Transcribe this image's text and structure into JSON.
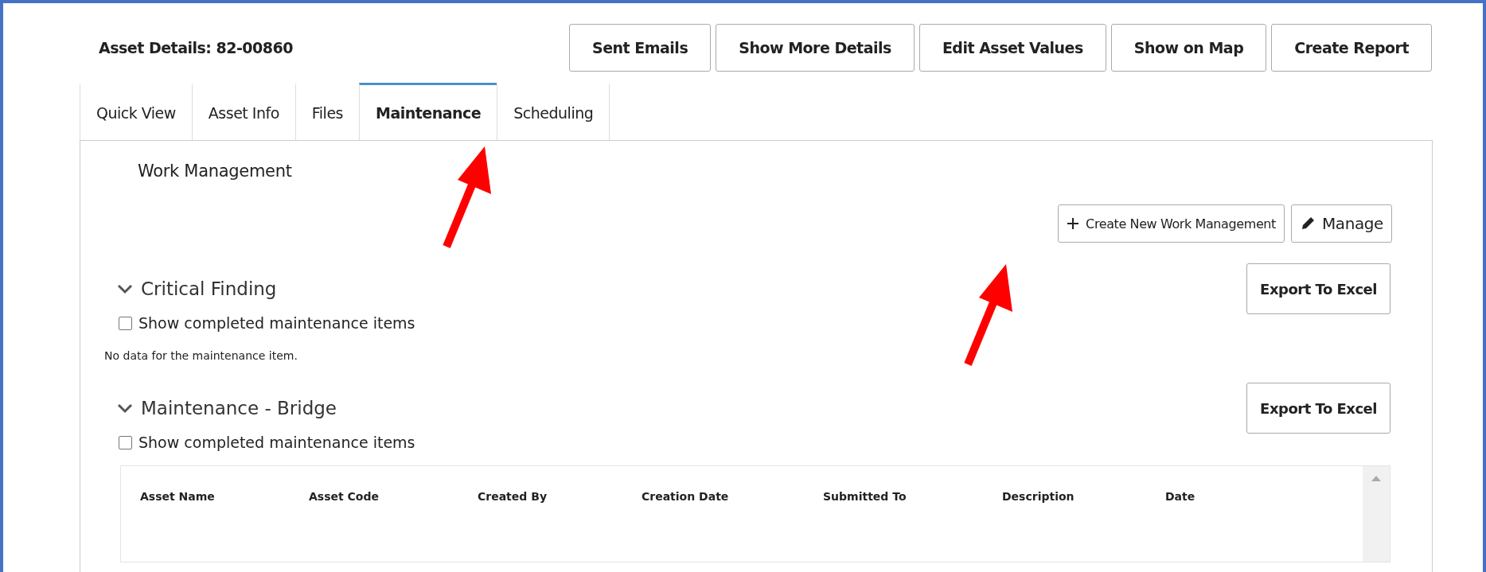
{
  "header": {
    "title": "Asset Details: 82-00860",
    "buttons": [
      "Sent Emails",
      "Show More Details",
      "Edit Asset Values",
      "Show on Map",
      "Create Report"
    ]
  },
  "tabs": [
    {
      "label": "Quick View",
      "selected": false
    },
    {
      "label": "Asset Info",
      "selected": false
    },
    {
      "label": "Files",
      "selected": false
    },
    {
      "label": "Maintenance",
      "selected": true
    },
    {
      "label": "Scheduling",
      "selected": false
    }
  ],
  "panel": {
    "title": "Work Management",
    "actions": [
      {
        "kind": "create",
        "label": "Create New Work Management"
      },
      {
        "kind": "manage",
        "label": "Manage"
      }
    ],
    "sections": [
      {
        "title": "Critical Finding",
        "expanded": true,
        "export_label": "Export To Excel",
        "show_completed": {
          "label": "Show completed maintenance items",
          "checked": false
        },
        "empty_message": "No data for the maintenance item."
      },
      {
        "title": "Maintenance - Bridge",
        "expanded": true,
        "export_label": "Export To Excel",
        "show_completed": {
          "label": "Show completed maintenance items",
          "checked": false
        },
        "table": {
          "columns": [
            "Asset Name",
            "Asset Code",
            "Created By",
            "Creation Date",
            "Submitted To",
            "Description",
            "Date"
          ]
        }
      }
    ]
  }
}
